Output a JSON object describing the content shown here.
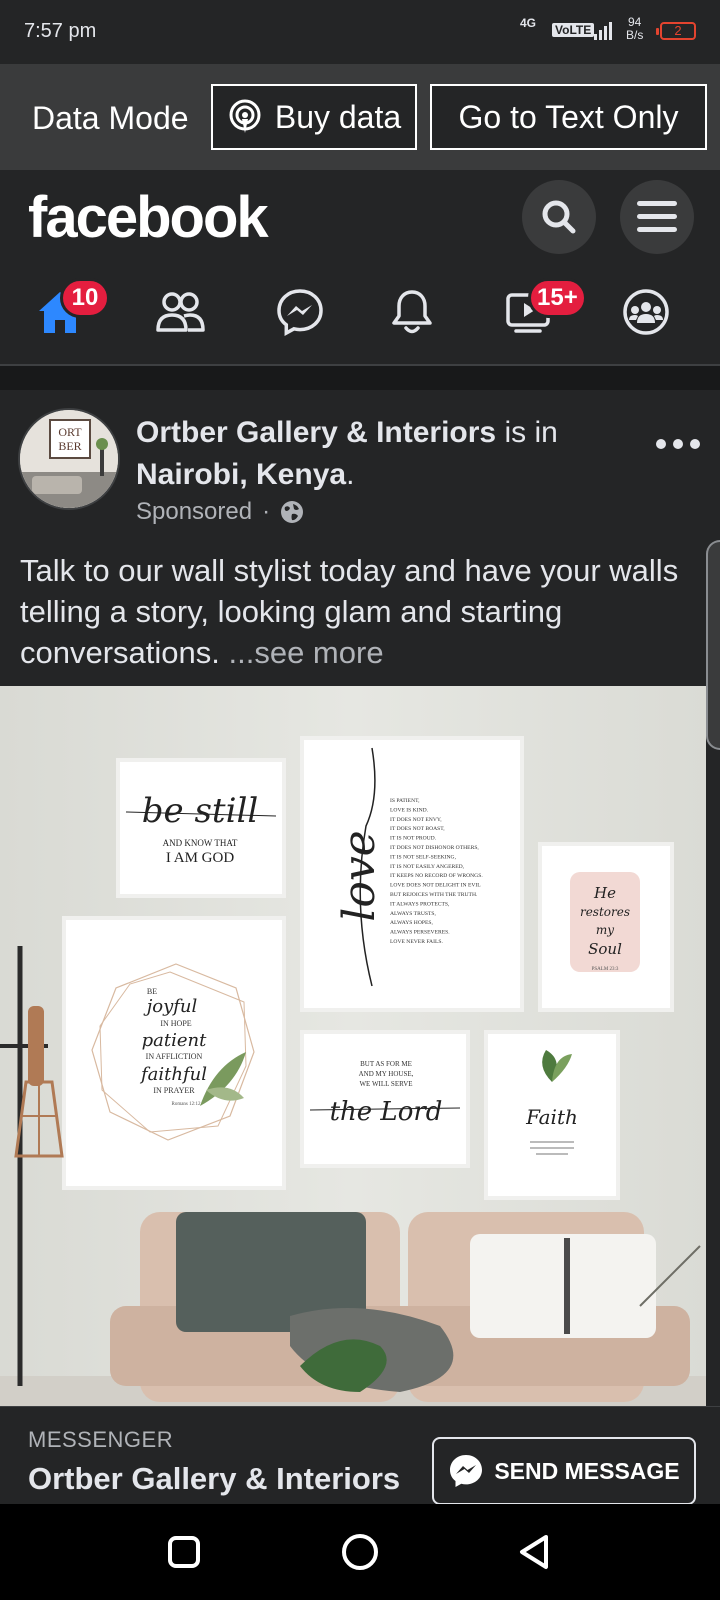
{
  "status_bar": {
    "time": "7:57 pm",
    "network": "4G",
    "volte": "VoLTE",
    "speed_value": "94",
    "speed_unit": "B/s",
    "battery": "2"
  },
  "data_mode": {
    "label": "Data Mode",
    "buy_data_label": "Buy data",
    "text_only_label": "Go to Text Only"
  },
  "header": {
    "logo_text": "facebook"
  },
  "nav": {
    "home_badge": "10",
    "video_badge": "15+",
    "accent_color": "#2d88ff",
    "badge_color": "#e41e3f"
  },
  "post": {
    "page_name": "Ortber Gallery & Interiors",
    "is_in": "is in",
    "location": "Nairobi, Kenya",
    "location_suffix": ".",
    "sponsored": "Sponsored",
    "dot": "·",
    "text": "Talk to our wall stylist today and have your walls telling a story, looking glam and starting conversations. ",
    "see_more": "...see more",
    "avatar_logo_line1": "ORT",
    "avatar_logo_line2": "BER",
    "image": {
      "frame_be_still_script": "be still",
      "frame_be_still_line1": "AND KNOW THAT",
      "frame_be_still_line2": "I AM GOD",
      "frame_love_script": "love",
      "frame_love_lines": [
        "IS PATIENT,",
        "LOVE IS KIND.",
        "IT DOES NOT ENVY,",
        "IT DOES NOT BOAST,",
        "IT IS NOT PROUD.",
        "IT DOES NOT DISHONOR OTHERS,",
        "IT IS NOT SELF-SEEKING,",
        "IT IS NOT EASILY ANGERED,",
        "IT KEEPS NO RECORD OF WRONGS.",
        "LOVE DOES NOT DELIGHT IN EVIL",
        "BUT REJOICES WITH THE TRUTH.",
        "IT ALWAYS PROTECTS,",
        "ALWAYS TRUSTS,",
        "ALWAYS HOPES,",
        "ALWAYS PERSEVERES.",
        "LOVE NEVER FAILS."
      ],
      "frame_soul_line1": "He",
      "frame_soul_line2": "restores",
      "frame_soul_line3": "my",
      "frame_soul_line4": "Soul",
      "frame_soul_ref": "PSALM 23:3",
      "frame_joyful_be": "BE",
      "frame_joyful_1": "joyful",
      "frame_joyful_2": "IN HOPE",
      "frame_joyful_3": "patient",
      "frame_joyful_4": "IN AFFLICTION",
      "frame_joyful_5": "faithful",
      "frame_joyful_6": "IN PRAYER",
      "frame_joyful_ref": "Romans 12:12",
      "frame_lord_line1": "BUT AS FOR ME",
      "frame_lord_line2": "AND MY HOUSE,",
      "frame_lord_line3": "WE WILL SERVE",
      "frame_lord_script": "the Lord",
      "frame_faith_script": "Faith"
    }
  },
  "cta": {
    "kicker": "MESSENGER",
    "name": "Ortber Gallery & Interiors",
    "button_label": "SEND MESSAGE"
  }
}
